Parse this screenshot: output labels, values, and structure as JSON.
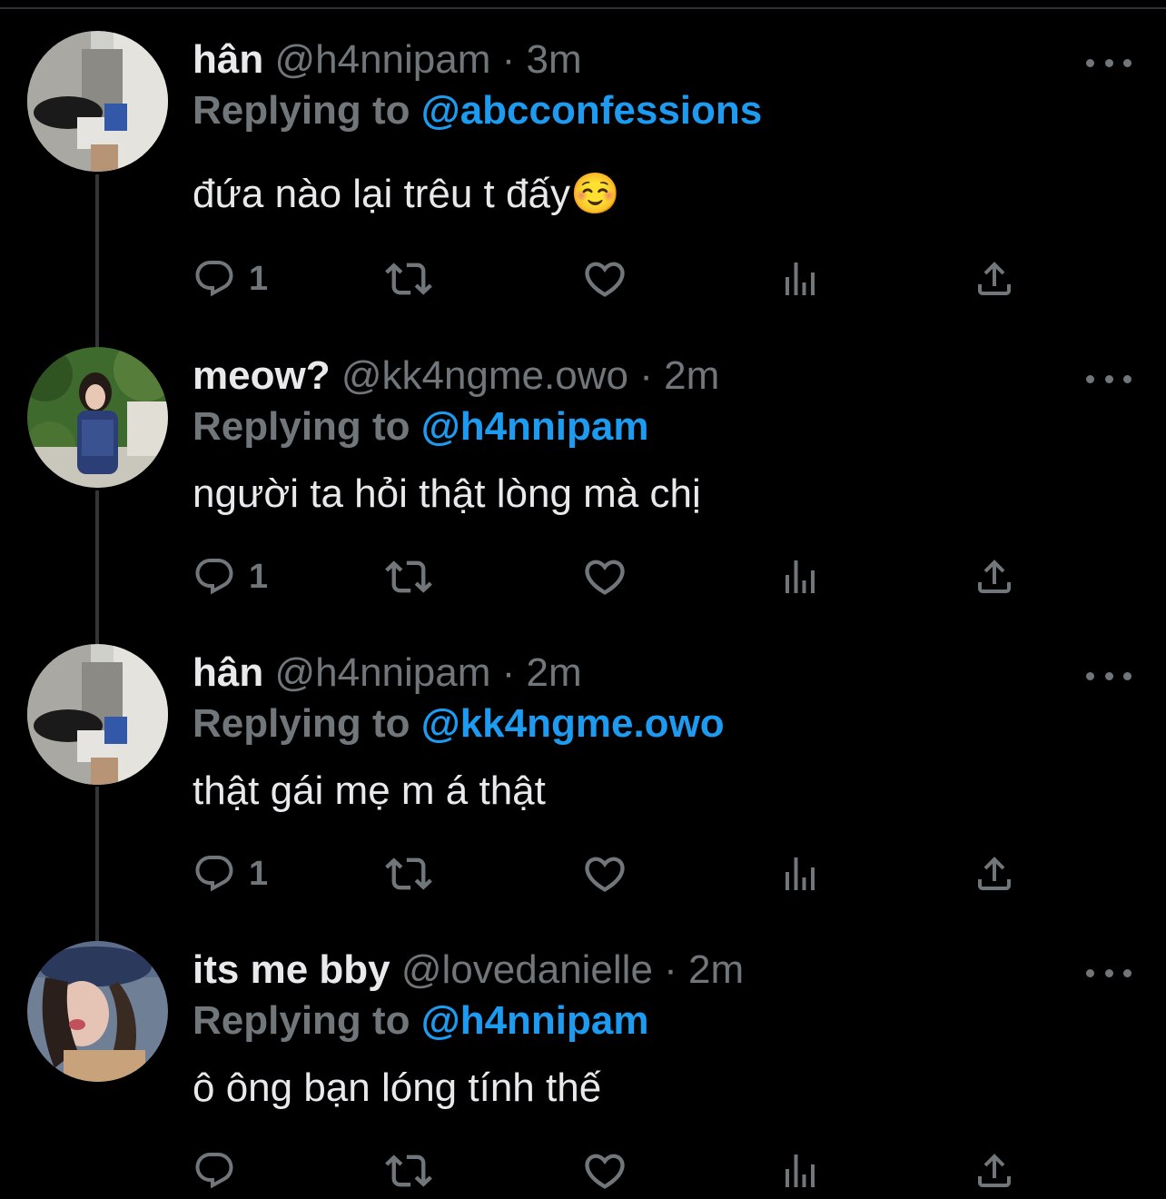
{
  "tweets": [
    {
      "name": "hân",
      "handle": "@h4nnipam",
      "separator": "·",
      "time": "3m",
      "reply_prefix": "Replying to",
      "reply_target": "@abcconfessions",
      "text": "đứa nào lại trêu t đấy☺️",
      "reply_count": "1",
      "avatar": "avatar-han"
    },
    {
      "name": "meow?",
      "handle": "@kk4ngme.owo",
      "separator": "·",
      "time": "2m",
      "reply_prefix": "Replying to",
      "reply_target": "@h4nnipam",
      "text": "người ta hỏi thật lòng mà chị",
      "reply_count": "1",
      "avatar": "avatar-meow"
    },
    {
      "name": "hân",
      "handle": "@h4nnipam",
      "separator": "·",
      "time": "2m",
      "reply_prefix": "Replying to",
      "reply_target": "@kk4ngme.owo",
      "text": "thật gái mẹ m á thật",
      "reply_count": "1",
      "avatar": "avatar-han"
    },
    {
      "name": "its me bby",
      "handle": "@lovedanielle",
      "separator": "·",
      "time": "2m",
      "reply_prefix": "Replying to",
      "reply_target": "@h4nnipam",
      "text": "ô ông bạn lóng tính thế",
      "reply_count": "",
      "avatar": "avatar-bby"
    }
  ],
  "icons": {
    "reply": "reply-icon",
    "retweet": "retweet-icon",
    "like": "like-icon",
    "views": "views-icon",
    "share": "share-icon",
    "more": "more-icon"
  },
  "colors": {
    "background": "#000000",
    "text": "#e7e9ea",
    "muted": "#71767b",
    "link": "#1d9bf0",
    "thread_line": "#333639"
  }
}
